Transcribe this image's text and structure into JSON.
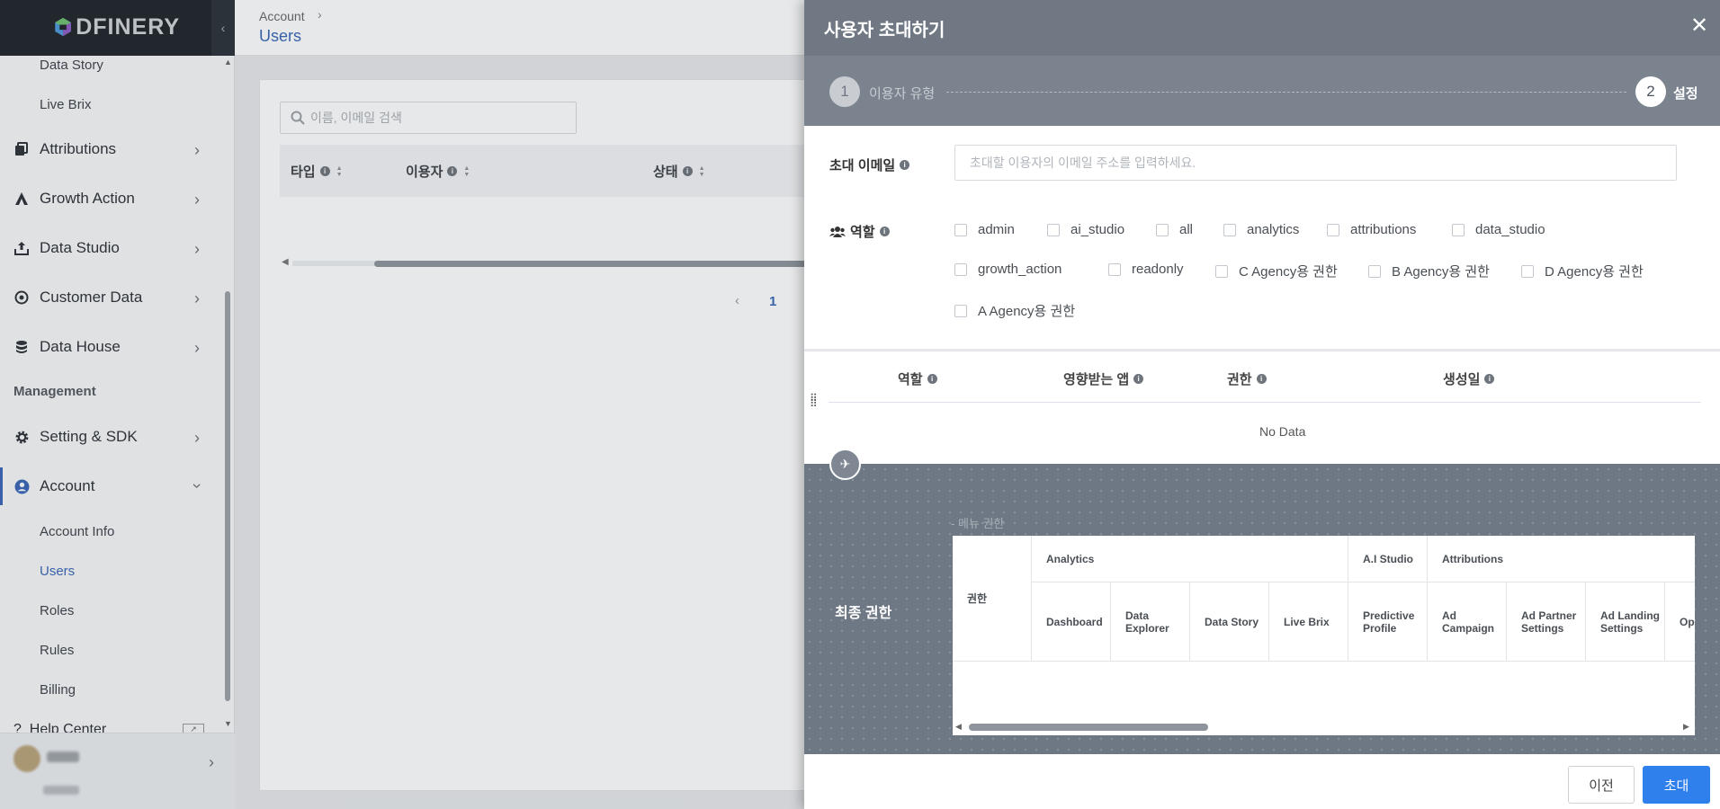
{
  "brand": {
    "logo_text": "DFINERY"
  },
  "sidebar": {
    "sub_top": [
      {
        "label": "Data Story"
      },
      {
        "label": "Live Brix"
      }
    ],
    "items": [
      {
        "label": "Attributions",
        "icon": "copy-icon"
      },
      {
        "label": "Growth Action",
        "icon": "growth-icon"
      },
      {
        "label": "Data Studio",
        "icon": "upload-icon"
      },
      {
        "label": "Customer Data",
        "icon": "target-icon"
      },
      {
        "label": "Data House",
        "icon": "database-icon"
      }
    ],
    "section_management": "Management",
    "setting": {
      "label": "Setting & SDK",
      "icon": "gear-icon"
    },
    "account": {
      "label": "Account",
      "icon": "user-circle-icon"
    },
    "account_sub": [
      {
        "label": "Account Info"
      },
      {
        "label": "Users"
      },
      {
        "label": "Roles"
      },
      {
        "label": "Rules"
      },
      {
        "label": "Billing"
      }
    ],
    "help": {
      "label": "Help Center"
    }
  },
  "header": {
    "breadcrumb_parent": "Account",
    "breadcrumb_current": "Users"
  },
  "users_page": {
    "search_placeholder": "이름, 이메일 검색",
    "columns": [
      "타입",
      "이용자",
      "상태"
    ],
    "pagination": {
      "prev": "‹",
      "current": "1"
    }
  },
  "drawer": {
    "title": "사용자 초대하기",
    "close": "✕",
    "steps": [
      {
        "num": "1",
        "label": "이용자 유형"
      },
      {
        "num": "2",
        "label": "설정"
      }
    ],
    "email": {
      "label": "초대 이메일",
      "placeholder": "초대할 이용자의 이메일 주소를 입력하세요."
    },
    "roles": {
      "label": "역할",
      "options": [
        "admin",
        "ai_studio",
        "all",
        "analytics",
        "attributions",
        "data_studio",
        "growth_action",
        "readonly",
        "C Agency용 권한",
        "B Agency용 권한",
        "D Agency용 권한",
        "A Agency용 권한"
      ]
    },
    "role_table": {
      "columns": [
        "역할",
        "영향받는 앱",
        "권한",
        "생성일"
      ],
      "empty": "No Data"
    },
    "final": {
      "title": "최종 권한",
      "menu_perm_label": "- 메뉴 권한",
      "perm_header": "권한",
      "groups": [
        "Analytics",
        "A.I Studio",
        "Attributions"
      ],
      "subcolumns": [
        "Dashboard",
        "Data Explorer",
        "Data Story",
        "Live Brix",
        "Predictive Profile",
        "Ad Campaign",
        "Ad Partner Settings",
        "Ad Landing Settings",
        "Op At Me"
      ]
    },
    "footer": {
      "prev": "이전",
      "invite": "초대"
    }
  },
  "colors": {
    "accent": "#2f80ed",
    "drawer_header": "#6f7883",
    "link": "#3a66b8"
  }
}
